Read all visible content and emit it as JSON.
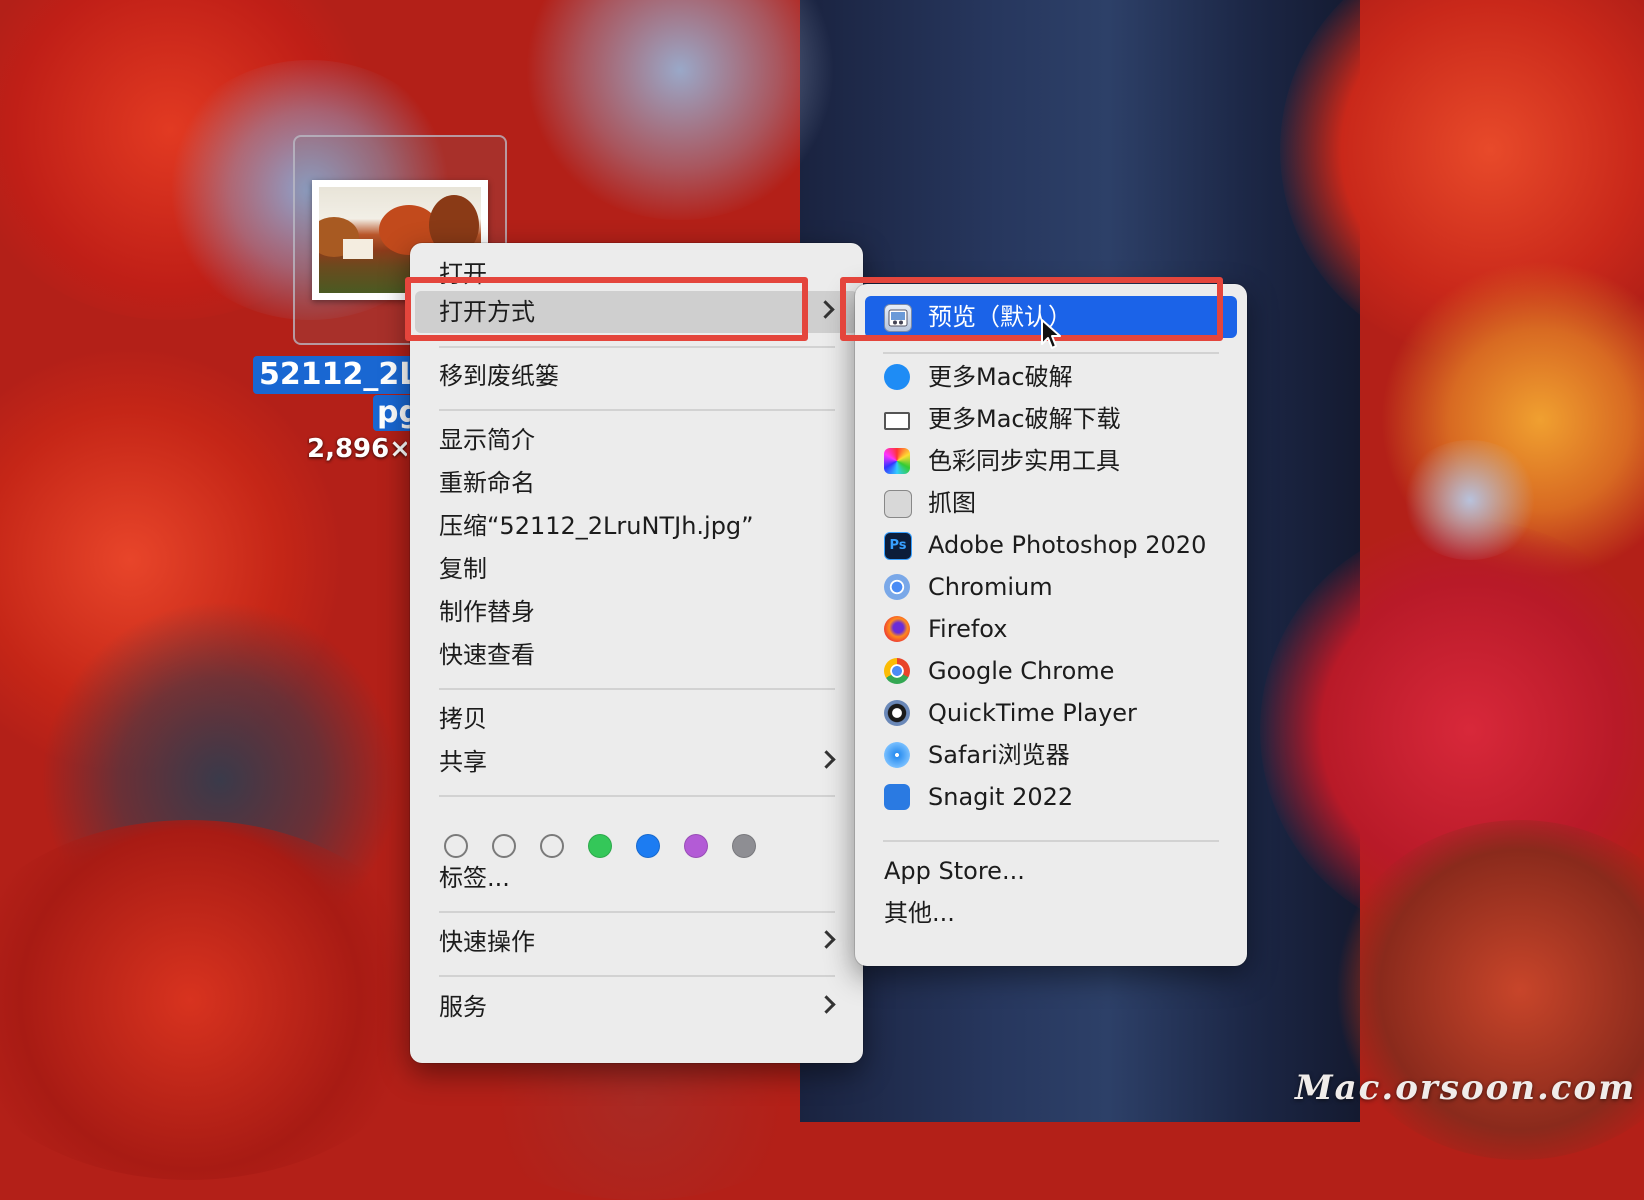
{
  "desktop": {
    "file": {
      "name_line1": "52112_2L",
      "name_line2": "pg",
      "size_text": "2,896×"
    },
    "watermark": "Mac.orsoon.com"
  },
  "context_menu": {
    "open": "打开",
    "open_with": "打开方式",
    "move_to_trash": "移到废纸篓",
    "get_info": "显示简介",
    "rename": "重新命名",
    "compress": "压缩“52112_2LruNTJh.jpg”",
    "duplicate": "复制",
    "make_alias": "制作替身",
    "quick_look": "快速查看",
    "copy": "拷贝",
    "share": "共享",
    "tags_label": "标签...",
    "tag_colors": [
      "none",
      "none",
      "none",
      "#34c759",
      "#1c7cf2",
      "#b35bd6",
      "#8e8e93"
    ],
    "quick_actions": "快速操作",
    "services": "服务"
  },
  "open_with_menu": {
    "default_app": "预览（默认）",
    "apps": [
      {
        "label": "更多Mac破解",
        "icon": "app-store-icon"
      },
      {
        "label": "更多Mac破解下载",
        "icon": "window-icon"
      },
      {
        "label": "色彩同步实用工具",
        "icon": "colorsync-icon"
      },
      {
        "label": "抓图",
        "icon": "grab-icon"
      },
      {
        "label": "Adobe Photoshop 2020",
        "icon": "photoshop-icon"
      },
      {
        "label": "Chromium",
        "icon": "chromium-icon"
      },
      {
        "label": "Firefox",
        "icon": "firefox-icon"
      },
      {
        "label": "Google Chrome",
        "icon": "chrome-icon"
      },
      {
        "label": "QuickTime Player",
        "icon": "quicktime-icon"
      },
      {
        "label": "Safari浏览器",
        "icon": "safari-icon"
      },
      {
        "label": "Snagit 2022",
        "icon": "snagit-icon"
      }
    ],
    "app_store": "App Store...",
    "other": "其他..."
  },
  "icons": {
    "photoshop_text": "Ps"
  }
}
